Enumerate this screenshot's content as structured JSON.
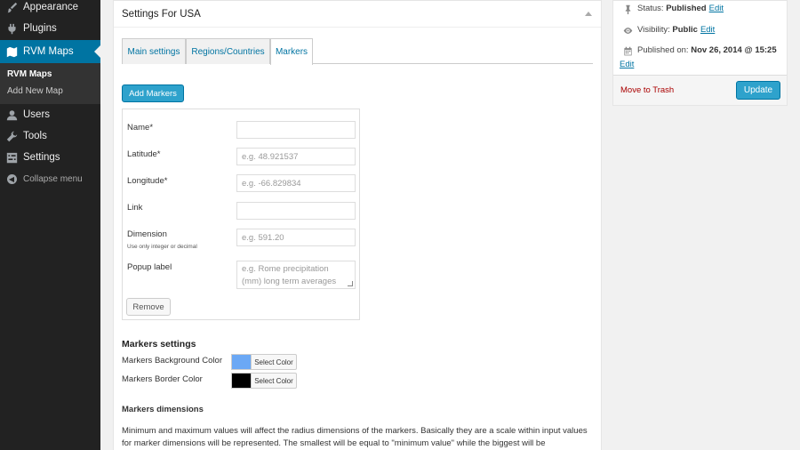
{
  "sidebar": {
    "items": [
      {
        "label": "Appearance",
        "icon": "brush-icon"
      },
      {
        "label": "Plugins",
        "icon": "plug-icon"
      },
      {
        "label": "RVM Maps",
        "icon": "map-icon",
        "active": true
      },
      {
        "label": "Users",
        "icon": "user-icon"
      },
      {
        "label": "Tools",
        "icon": "wrench-icon"
      },
      {
        "label": "Settings",
        "icon": "settings-icon"
      },
      {
        "label": "Collapse menu",
        "icon": "collapse-icon"
      }
    ],
    "submenu": [
      {
        "label": "RVM Maps",
        "current": true
      },
      {
        "label": "Add New Map"
      }
    ],
    "active_color": "#0074a2"
  },
  "metabox": {
    "title": "Settings For USA",
    "tabs": [
      {
        "label": "Main settings"
      },
      {
        "label": "Regions/Countries"
      },
      {
        "label": "Markers",
        "active": true
      }
    ],
    "add_markers_label": "Add Markers",
    "form": {
      "name_label": "Name*",
      "name_value": "",
      "latitude_label": "Latitude*",
      "latitude_placeholder": "e.g. 48.921537",
      "longitude_label": "Longitude*",
      "longitude_placeholder": "e.g. -66.829834",
      "link_label": "Link",
      "link_value": "",
      "dimension_label": "Dimension",
      "dimension_hint": "Use only integer or decimal",
      "dimension_placeholder": "e.g. 591.20",
      "popup_label": "Popup label",
      "popup_placeholder": "e.g. Rome precipitation (mm) long term averages",
      "remove_label": "Remove"
    },
    "markers_settings": {
      "heading": "Markers settings",
      "bg_label": "Markers Background Color",
      "bg_color": "#6ba8f5",
      "border_label": "Markers Border Color",
      "border_color": "#000000",
      "select_color_label": "Select Color"
    },
    "markers_dimensions": {
      "heading": "Markers dimensions",
      "text": "Minimum and maximum values will affect the radius dimensions of the markers. Basically they are a scale within input values for marker dimensions will be represented. The smallest will be equal to \"minimum value\" while the biggest will be"
    }
  },
  "publish": {
    "status_label": "Status:",
    "status_value": "Published",
    "visibility_label": "Visibility:",
    "visibility_value": "Public",
    "published_label": "Published on:",
    "published_value": "Nov 26, 2014 @ 15:25",
    "edit_label": "Edit",
    "trash_label": "Move to Trash",
    "update_label": "Update",
    "accent_color": "#2ea2cc",
    "trash_color": "#aa0000"
  }
}
